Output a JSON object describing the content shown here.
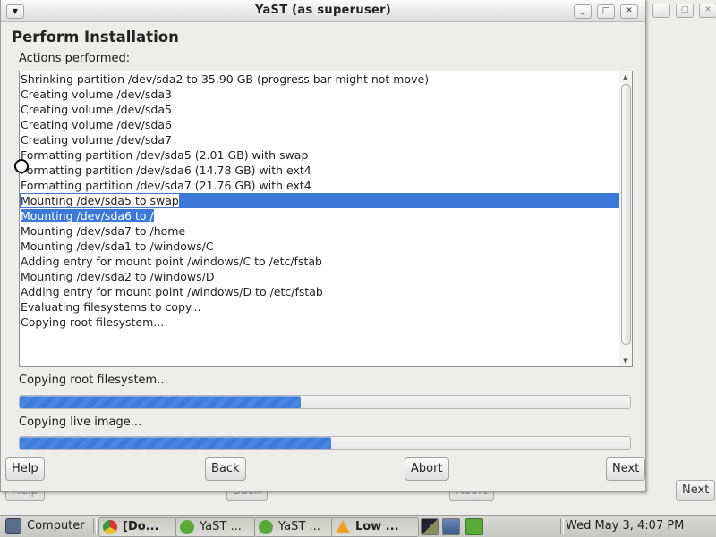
{
  "background_window": {
    "buttons": [
      "Help",
      "Back",
      "Abort",
      "Next"
    ]
  },
  "window": {
    "title": "YaST (as superuser)",
    "heading": "Perform Installation",
    "actions_label": "Actions performed:",
    "log_lines": [
      "Shrinking partition /dev/sda2 to 35.90 GB (progress bar might not move)",
      "Creating volume /dev/sda3",
      "Creating volume /dev/sda5",
      "Creating volume /dev/sda6",
      "Creating volume /dev/sda7",
      "Formatting partition /dev/sda5 (2.01 GB) with swap",
      "Formatting partition /dev/sda6 (14.78 GB) with ext4",
      "Formatting partition /dev/sda7 (21.76 GB) with ext4",
      "Mounting /dev/sda5 to swap",
      "Mounting /dev/sda6 to /",
      "Mounting /dev/sda7 to /home",
      "Mounting /dev/sda1 to /windows/C",
      "Adding entry for mount point /windows/C to /etc/fstab",
      "Mounting /dev/sda2 to /windows/D",
      "Adding entry for mount point /windows/D to /etc/fstab",
      "Evaluating filesystems to copy...",
      "Copying root filesystem..."
    ],
    "progress": [
      {
        "label": "Copying root filesystem...",
        "value": 0.46
      },
      {
        "label": "Copying live image...",
        "value": 0.51
      }
    ],
    "buttons": {
      "help": "Help",
      "back": "Back",
      "abort": "Abort",
      "next": "Next"
    }
  },
  "taskbar": {
    "items": [
      {
        "label": "Computer",
        "icon": "computer-icon"
      },
      {
        "label": "[Do...",
        "icon": "chrome-icon"
      },
      {
        "label": "YaST ...",
        "icon": "yast-icon"
      },
      {
        "label": "YaST ...",
        "icon": "yast-icon"
      },
      {
        "label": "Low ...",
        "icon": "warning-icon"
      }
    ],
    "clock": "Wed May  3,  4:07 PM"
  },
  "colors": {
    "selection": "#3c78d8",
    "progress": "#4a86e4",
    "window_bg": "#ededeb",
    "warning": "#f0a020"
  }
}
